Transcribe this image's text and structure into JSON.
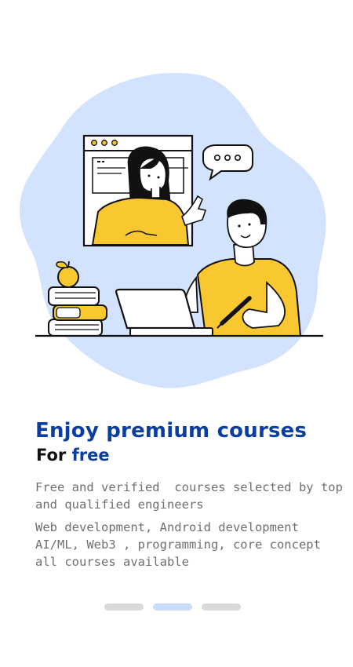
{
  "onboarding": {
    "headline": "Enjoy premium courses",
    "subheadline_prefix": "For ",
    "subheadline_accent": "free",
    "description_1": [
      "Free and verified  courses selected by top",
      "and qualified engineers"
    ],
    "description_2": [
      "Web development, Android development",
      "AI/ML, Web3 , programming, core concept",
      "all courses available"
    ]
  },
  "pager": {
    "pages": 3,
    "active_index": 1
  },
  "colors": {
    "accent_blue": "#0c3da0",
    "blob": "#d3e2fd",
    "yellow": "#f9c830",
    "text_gray": "#6f6f6f",
    "dot_inactive": "#d9d9d9",
    "dot_active": "#c8dcfb"
  },
  "icons": {
    "speech_bubble": "speech-bubble-icon",
    "window_dots": "window-dots-icon"
  }
}
